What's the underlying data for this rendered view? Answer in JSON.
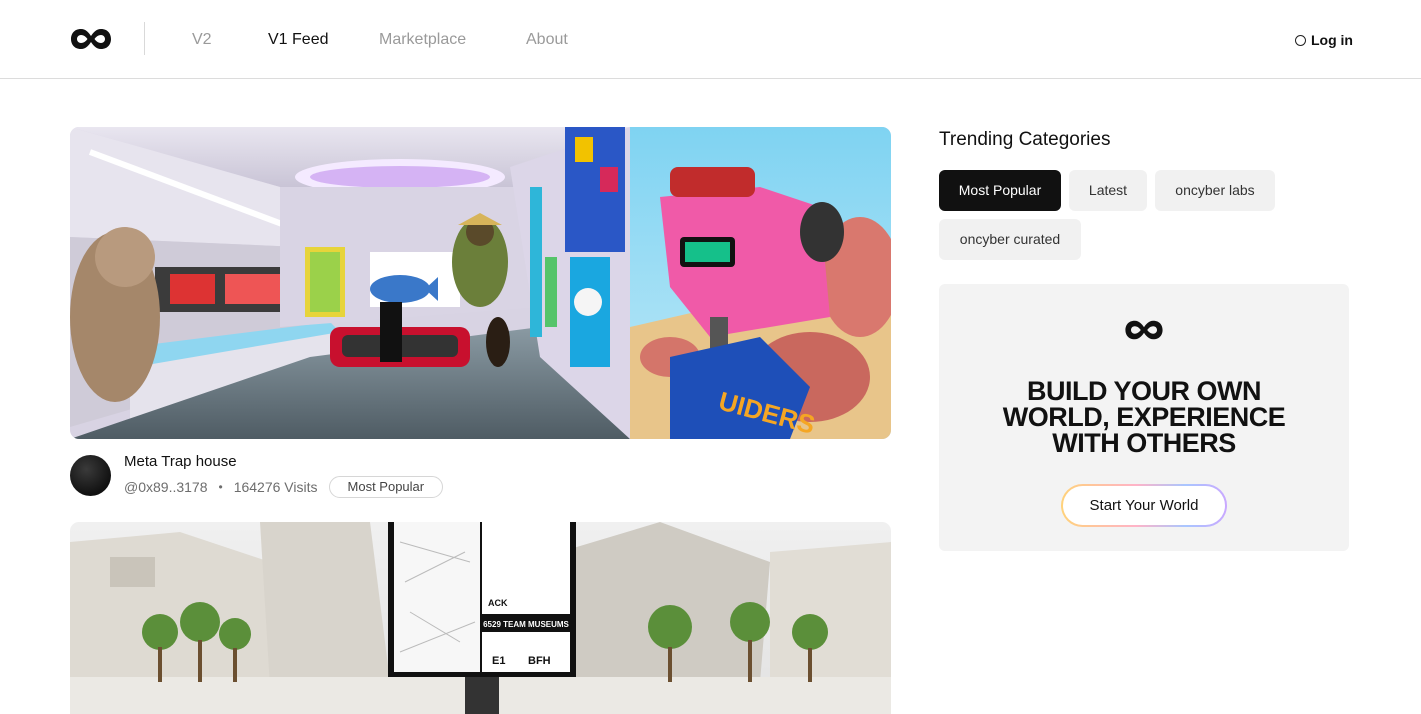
{
  "header": {
    "logo_icon": "oncyber-infinity-logo",
    "nav": [
      {
        "label": "V2",
        "active": false
      },
      {
        "label": "V1 Feed",
        "active": true
      },
      {
        "label": "Marketplace",
        "active": false
      },
      {
        "label": "About",
        "active": false
      }
    ],
    "login_label": "Log in",
    "login_icon": "circle-icon"
  },
  "feed": {
    "items": [
      {
        "title": "Meta Trap house",
        "author": "@0x89..3178",
        "visits": "164276 Visits",
        "tag": "Most Popular"
      },
      {
        "title": "",
        "image_caption_text": [
          "ACK",
          "6529 TEAM MUSEUMS",
          "BFH"
        ]
      }
    ]
  },
  "sidebar": {
    "trending_title": "Trending Categories",
    "categories": [
      {
        "label": "Most Popular",
        "active": true
      },
      {
        "label": "Latest",
        "active": false
      },
      {
        "label": "oncyber labs",
        "active": false
      },
      {
        "label": "oncyber curated",
        "active": false
      }
    ],
    "promo": {
      "logo_icon": "oncyber-infinity-logo",
      "headline": "BUILD YOUR OWN\nWORLD, EXPERIENCE\nWITH OTHERS",
      "button_label": "Start Your World"
    }
  },
  "colors": {
    "active_pill": "#111111",
    "pill_bg": "#f1f1f1",
    "promo_bg": "#f3f3f3",
    "nav_inactive": "#9a9a9a"
  }
}
